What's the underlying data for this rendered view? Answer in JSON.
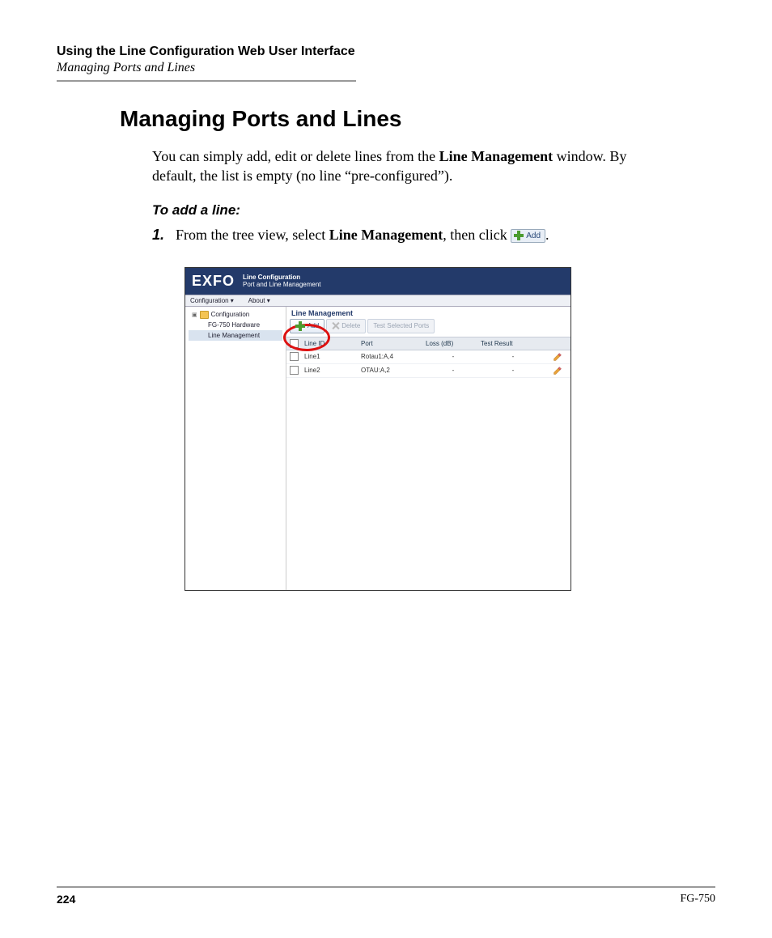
{
  "header": {
    "chapter": "Using the Line Configuration Web User Interface",
    "section": "Managing Ports and Lines"
  },
  "main": {
    "heading": "Managing Ports and Lines",
    "intro_pre": "You can simply add, edit or delete lines from the ",
    "intro_bold": "Line Management",
    "intro_post": " window. By default, the list is empty (no line “pre-configured”).",
    "subheading": "To add a line:",
    "step1_num": "1.",
    "step1_pre": "From the tree view, select ",
    "step1_bold": "Line Management",
    "step1_mid": ", then click ",
    "step1_btn_label": "Add",
    "step1_end": "."
  },
  "screenshot": {
    "logo": "EXFO",
    "title": "Line Configuration",
    "subtitle": "Port and Line Management",
    "menu": {
      "configuration": "Configuration ▾",
      "about": "About ▾"
    },
    "tree": {
      "root": "Configuration",
      "hw": "FG-750 Hardware",
      "lm": "Line Management"
    },
    "panel_title": "Line Management",
    "toolbar": {
      "add": "Add",
      "delete": "Delete",
      "test": "Test Selected Ports"
    },
    "columns": {
      "check": "",
      "lineid": "Line ID",
      "port": "Port",
      "loss": "Loss (dB)",
      "result": "Test Result",
      "edit": ""
    },
    "rows": [
      {
        "lineid": "Line1",
        "port": "Rotau1:A,4",
        "loss": "-",
        "result": "-"
      },
      {
        "lineid": "Line2",
        "port": "OTAU:A,2",
        "loss": "-",
        "result": "-"
      }
    ]
  },
  "footer": {
    "page": "224",
    "product": "FG-750"
  }
}
